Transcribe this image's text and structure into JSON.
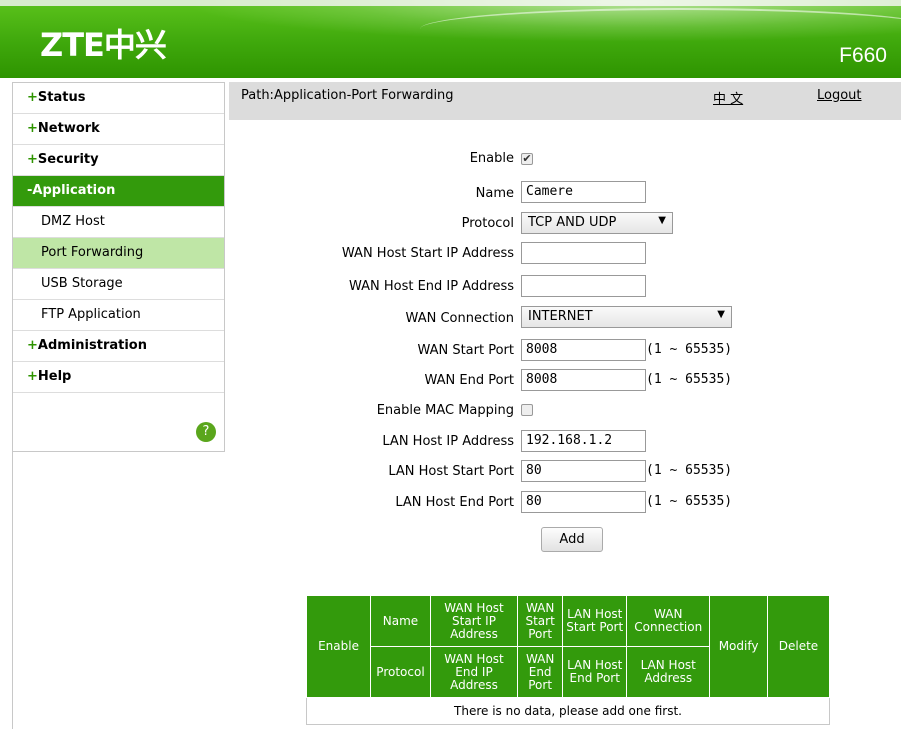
{
  "header": {
    "logo": "ZTE中兴",
    "model": "F660"
  },
  "sidebar": {
    "items": [
      {
        "prefix": "+",
        "label": "Status"
      },
      {
        "prefix": "+",
        "label": "Network"
      },
      {
        "prefix": "+",
        "label": "Security"
      },
      {
        "prefix": "-",
        "label": "Application"
      },
      {
        "prefix": "+",
        "label": "Administration"
      },
      {
        "prefix": "+",
        "label": "Help"
      }
    ],
    "subitems": [
      "DMZ Host",
      "Port Forwarding",
      "USB Storage",
      "FTP Application"
    ],
    "selected": "Port Forwarding",
    "help_glyph": "?"
  },
  "pathbar": {
    "path": "Path:Application-Port Forwarding",
    "lang": "中 文",
    "logout": "Logout"
  },
  "form": {
    "enable": {
      "label": "Enable",
      "checked": true,
      "mark": "✔"
    },
    "name": {
      "label": "Name",
      "value": "Camere"
    },
    "protocol": {
      "label": "Protocol",
      "value": "TCP AND UDP"
    },
    "wan_host_start": {
      "label": "WAN Host Start IP Address",
      "value": ""
    },
    "wan_host_end": {
      "label": "WAN Host End IP Address",
      "value": ""
    },
    "wan_connection": {
      "label": "WAN Connection",
      "value": "INTERNET"
    },
    "wan_start_port": {
      "label": "WAN Start Port",
      "value": "8008",
      "range": "(1 ~ 65535)"
    },
    "wan_end_port": {
      "label": "WAN End Port",
      "value": "8008",
      "range": "(1 ~ 65535)"
    },
    "mac_mapping": {
      "label": "Enable MAC Mapping",
      "checked": false
    },
    "lan_host_ip": {
      "label": "LAN Host IP Address",
      "value": "192.168.1.2"
    },
    "lan_start_port": {
      "label": "LAN Host Start Port",
      "value": "80",
      "range": "(1 ~ 65535)"
    },
    "lan_end_port": {
      "label": "LAN Host End Port",
      "value": "80",
      "range": "(1 ~ 65535)"
    },
    "add_label": "Add"
  },
  "table": {
    "enable": "Enable",
    "name": "Name",
    "wan_host_start": "WAN Host Start IP Address",
    "wan_start_port": "WAN Start Port",
    "lan_host_start": "LAN Host Start Port",
    "wan_connection": "WAN Connection",
    "modify": "Modify",
    "delete": "Delete",
    "protocol": "Protocol",
    "wan_host_end": "WAN Host End IP Address",
    "wan_end_port": "WAN End Port",
    "lan_host_end": "LAN Host End Port",
    "lan_host_address": "LAN Host Address",
    "empty": "There is no data, please add one first."
  },
  "colors": {
    "brand_green": "#339a0c",
    "selected_bg": "#bfe6a6",
    "pathbar_bg": "#dcdcdc"
  }
}
